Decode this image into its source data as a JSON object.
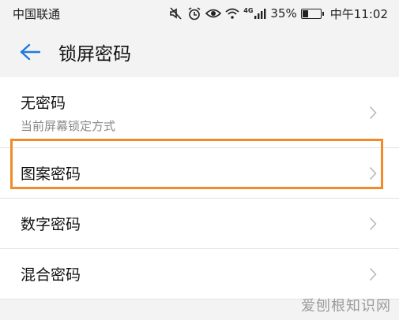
{
  "status_bar": {
    "carrier": "中国联通",
    "network_badge": "4G",
    "battery": "35%",
    "battery_level": 0.35,
    "time": "中午11:02",
    "icons": [
      "mute-icon",
      "alarm-icon",
      "eye-comfort-icon",
      "wifi-icon",
      "signal-icon",
      "battery-icon"
    ]
  },
  "app_bar": {
    "title": "锁屏密码",
    "back_icon": "arrow-left-icon"
  },
  "list": {
    "items": [
      {
        "label": "无密码",
        "subtitle": "当前屏幕锁定方式"
      },
      {
        "label": "图案密码"
      },
      {
        "label": "数字密码"
      },
      {
        "label": "混合密码"
      }
    ]
  },
  "highlight_color": "#f28a2a",
  "accent_color": "#1f7ae0",
  "watermark": "爱刨根知识网"
}
